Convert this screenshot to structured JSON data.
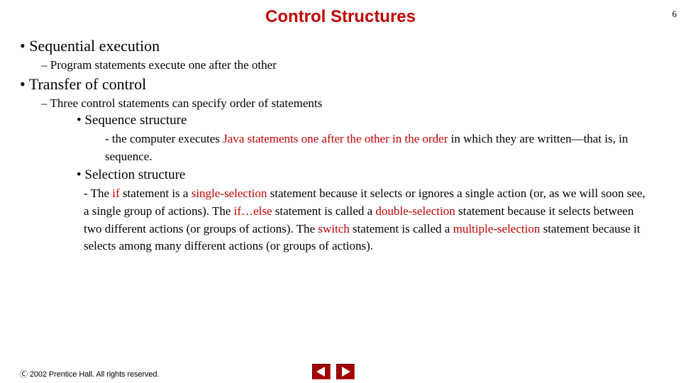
{
  "page_number": "6",
  "title": "Control Structures",
  "bullets": {
    "seq_exec": "Sequential execution",
    "seq_exec_sub": "Program statements execute one after the other",
    "transfer": "Transfer of control",
    "transfer_sub": "Three control statements can specify order of statements",
    "seq_struct": "Sequence structure",
    "seq_struct_pre": "- the computer executes ",
    "seq_struct_red": "Java statements one after the other in the order",
    "seq_struct_post": " in which they are written—that is, in sequence.",
    "sel_struct": "Selection structure",
    "sel_p1a": "- The ",
    "sel_if": "if",
    "sel_p1b": " statement is a ",
    "sel_single": "single-selection",
    "sel_p1c": " statement because it selects or ignores a single action (or, as we will soon see, a single group of actions). The ",
    "sel_ifelse": "if…else",
    "sel_p1d": " statement is called a ",
    "sel_double": "double-selection",
    "sel_p1e": " statement because it selects between two different actions (or groups of actions). The ",
    "sel_switch": "switch",
    "sel_p1f": " statement is called a ",
    "sel_multiple": "multiple-selection",
    "sel_p1g": " statement because it selects among many different actions (or groups of actions)."
  },
  "copyright": "Ⓒ 2002 Prentice Hall. All rights reserved."
}
